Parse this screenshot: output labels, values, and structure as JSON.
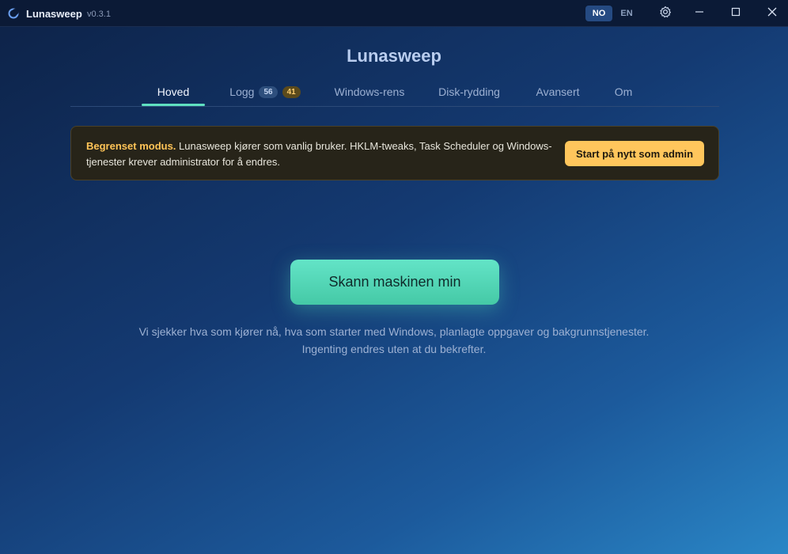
{
  "window": {
    "app_name": "Lunasweep",
    "version": "v0.3.1",
    "languages": [
      "NO",
      "EN"
    ],
    "active_language": "NO"
  },
  "header": {
    "title": "Lunasweep",
    "tabs": [
      {
        "label": "Hoved",
        "active": true
      },
      {
        "label": "Logg",
        "badges": [
          "56",
          "41"
        ]
      },
      {
        "label": "Windows-rens"
      },
      {
        "label": "Disk-rydding"
      },
      {
        "label": "Avansert"
      },
      {
        "label": "Om"
      }
    ]
  },
  "banner": {
    "strong": "Begrenset modus.",
    "text_line1": " Lunasweep kjører som vanlig bruker. HKLM-tweaks, Task Scheduler og Windows-",
    "text_line2": "tjenester krever administrator for å endres.",
    "button": "Start på nytt som admin"
  },
  "main": {
    "scan_button": "Skann maskinen min",
    "info_line1": "Vi sjekker hva som kjører nå, hva som starter med Windows, planlagte oppgaver og bakgrunnstjenester.",
    "info_line2": "Ingenting endres uten at du bekrefter."
  },
  "colors": {
    "accent": "#5fe0c0",
    "warning": "#ffc65c",
    "badge_blue": "#2e4f7d",
    "badge_yellow": "#5b4a1c"
  },
  "icons": [
    "moon-logo-icon",
    "gear-icon",
    "minimize-icon",
    "maximize-icon",
    "close-icon"
  ]
}
